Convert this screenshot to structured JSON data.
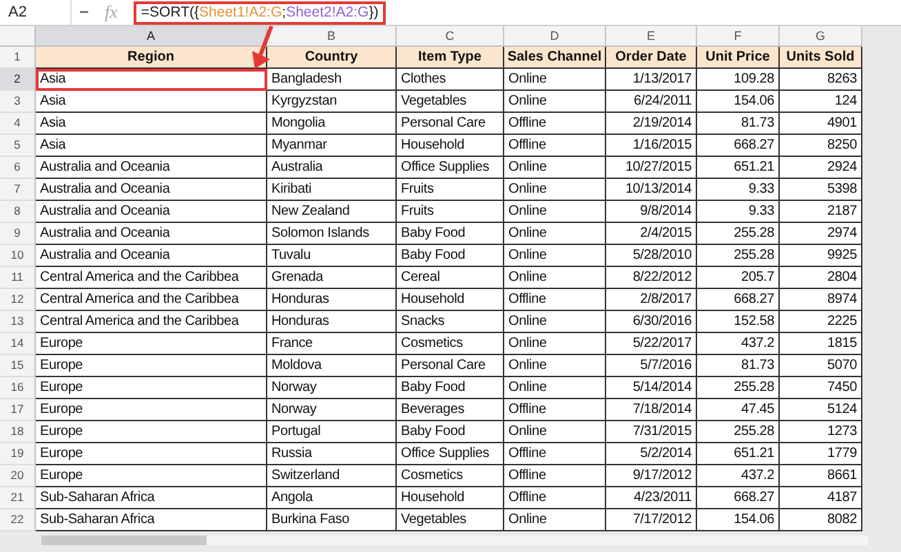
{
  "name_box": "A2",
  "fx_label": "fx",
  "formula": [
    {
      "text": "=SORT({",
      "color": "#222222"
    },
    {
      "text": "Sheet1!A2:G",
      "color": "#e69138"
    },
    {
      "text": ";",
      "color": "#222222"
    },
    {
      "text": "Sheet2!A2:G",
      "color": "#8e63ce"
    },
    {
      "text": "})",
      "color": "#222222"
    }
  ],
  "column_letters": [
    {
      "letter": "A",
      "selected": true
    },
    {
      "letter": "B",
      "selected": false
    },
    {
      "letter": "C",
      "selected": false
    },
    {
      "letter": "D",
      "selected": false
    },
    {
      "letter": "E",
      "selected": false
    },
    {
      "letter": "F",
      "selected": false
    },
    {
      "letter": "G",
      "selected": false
    }
  ],
  "table": {
    "header_row_number": "1",
    "columns": [
      {
        "heading": "Region",
        "kind": "text"
      },
      {
        "heading": "Country",
        "kind": "text"
      },
      {
        "heading": "Item Type",
        "kind": "text"
      },
      {
        "heading": "Sales Channel",
        "kind": "text"
      },
      {
        "heading": "Order Date",
        "kind": "number"
      },
      {
        "heading": "Unit Price",
        "kind": "number"
      },
      {
        "heading": "Units Sold",
        "kind": "number"
      }
    ],
    "rows": [
      {
        "number": "2",
        "selected": true,
        "cells": [
          "Asia",
          "Bangladesh",
          "Clothes",
          "Online",
          "1/13/2017",
          "109.28",
          "8263"
        ]
      },
      {
        "number": "3",
        "selected": false,
        "cells": [
          "Asia",
          "Kyrgyzstan",
          "Vegetables",
          "Online",
          "6/24/2011",
          "154.06",
          "124"
        ]
      },
      {
        "number": "4",
        "selected": false,
        "cells": [
          "Asia",
          "Mongolia",
          "Personal Care",
          "Offline",
          "2/19/2014",
          "81.73",
          "4901"
        ]
      },
      {
        "number": "5",
        "selected": false,
        "cells": [
          "Asia",
          "Myanmar",
          "Household",
          "Offline",
          "1/16/2015",
          "668.27",
          "8250"
        ]
      },
      {
        "number": "6",
        "selected": false,
        "cells": [
          "Australia and Oceania",
          "Australia",
          "Office Supplies",
          "Online",
          "10/27/2015",
          "651.21",
          "2924"
        ]
      },
      {
        "number": "7",
        "selected": false,
        "cells": [
          "Australia and Oceania",
          "Kiribati",
          "Fruits",
          "Online",
          "10/13/2014",
          "9.33",
          "5398"
        ]
      },
      {
        "number": "8",
        "selected": false,
        "cells": [
          "Australia and Oceania",
          "New Zealand",
          "Fruits",
          "Online",
          "9/8/2014",
          "9.33",
          "2187"
        ]
      },
      {
        "number": "9",
        "selected": false,
        "cells": [
          "Australia and Oceania",
          "Solomon Islands",
          "Baby Food",
          "Online",
          "2/4/2015",
          "255.28",
          "2974"
        ]
      },
      {
        "number": "10",
        "selected": false,
        "cells": [
          "Australia and Oceania",
          "Tuvalu",
          "Baby Food",
          "Online",
          "5/28/2010",
          "255.28",
          "9925"
        ]
      },
      {
        "number": "11",
        "selected": false,
        "cells": [
          "Central America and the Caribbea",
          "Grenada",
          "Cereal",
          "Online",
          "8/22/2012",
          "205.7",
          "2804"
        ]
      },
      {
        "number": "12",
        "selected": false,
        "cells": [
          "Central America and the Caribbea",
          "Honduras",
          "Household",
          "Offline",
          "2/8/2017",
          "668.27",
          "8974"
        ]
      },
      {
        "number": "13",
        "selected": false,
        "cells": [
          "Central America and the Caribbea",
          "Honduras",
          "Snacks",
          "Online",
          "6/30/2016",
          "152.58",
          "2225"
        ]
      },
      {
        "number": "14",
        "selected": false,
        "cells": [
          "Europe",
          "France",
          "Cosmetics",
          "Online",
          "5/22/2017",
          "437.2",
          "1815"
        ]
      },
      {
        "number": "15",
        "selected": false,
        "cells": [
          "Europe",
          "Moldova",
          "Personal Care",
          "Online",
          "5/7/2016",
          "81.73",
          "5070"
        ]
      },
      {
        "number": "16",
        "selected": false,
        "cells": [
          "Europe",
          "Norway",
          "Baby Food",
          "Online",
          "5/14/2014",
          "255.28",
          "7450"
        ]
      },
      {
        "number": "17",
        "selected": false,
        "cells": [
          "Europe",
          "Norway",
          "Beverages",
          "Offline",
          "7/18/2014",
          "47.45",
          "5124"
        ]
      },
      {
        "number": "18",
        "selected": false,
        "cells": [
          "Europe",
          "Portugal",
          "Baby Food",
          "Online",
          "7/31/2015",
          "255.28",
          "1273"
        ]
      },
      {
        "number": "19",
        "selected": false,
        "cells": [
          "Europe",
          "Russia",
          "Office Supplies",
          "Offline",
          "5/2/2014",
          "651.21",
          "1779"
        ]
      },
      {
        "number": "20",
        "selected": false,
        "cells": [
          "Europe",
          "Switzerland",
          "Cosmetics",
          "Offline",
          "9/17/2012",
          "437.2",
          "8661"
        ]
      },
      {
        "number": "21",
        "selected": false,
        "cells": [
          "Sub-Saharan Africa",
          "Angola",
          "Household",
          "Offline",
          "4/23/2011",
          "668.27",
          "4187"
        ]
      },
      {
        "number": "22",
        "selected": false,
        "cells": [
          "Sub-Saharan Africa",
          "Burkina Faso",
          "Vegetables",
          "Online",
          "7/17/2012",
          "154.06",
          "8082"
        ]
      }
    ]
  }
}
